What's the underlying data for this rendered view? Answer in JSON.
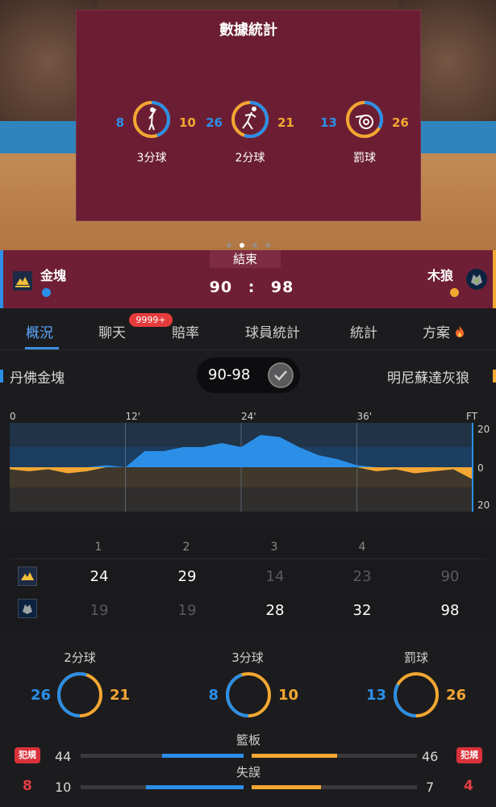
{
  "stats_card": {
    "title": "數據統計",
    "items": [
      {
        "label": "3分球",
        "left": "8",
        "right": "10",
        "icon": "shooter-icon"
      },
      {
        "label": "2分球",
        "left": "26",
        "right": "21",
        "icon": "layup-icon"
      },
      {
        "label": "罰球",
        "left": "13",
        "right": "26",
        "icon": "whistle-icon"
      }
    ],
    "page_count": 4,
    "active_page": 2
  },
  "scorebar": {
    "status": "結束",
    "home": {
      "name": "金塊",
      "color": "#2b8fe8"
    },
    "away": {
      "name": "木狼",
      "color": "#f3a733"
    },
    "home_score": "90",
    "separator": ":",
    "away_score": "98"
  },
  "tabs": [
    {
      "label": "概況",
      "active": true
    },
    {
      "label": "聊天"
    },
    {
      "label": "賠率"
    },
    {
      "label": "球員統計"
    },
    {
      "label": "統計"
    },
    {
      "label": "方案"
    }
  ],
  "chat_badge": "9999+",
  "matchup": {
    "home_full": "丹佛金塊",
    "away_full": "明尼蘇達灰狼",
    "score": "90-98"
  },
  "chart_data": {
    "type": "area",
    "x_ticks": [
      "0",
      "12'",
      "24'",
      "36'",
      "FT"
    ],
    "y_ticks": [
      "20",
      "0",
      "20"
    ],
    "x": [
      0,
      2,
      4,
      6,
      8,
      10,
      12,
      14,
      16,
      18,
      20,
      22,
      24,
      26,
      28,
      30,
      32,
      34,
      36,
      38,
      40,
      42,
      44,
      46,
      48
    ],
    "margin": [
      -1,
      -2,
      -1,
      -3,
      -2,
      1,
      0,
      8,
      8,
      10,
      10,
      12,
      10,
      16,
      15,
      10,
      6,
      4,
      1,
      -2,
      -1,
      -3,
      -2,
      -1,
      -6
    ],
    "colors": {
      "home": "#2b8fe8",
      "away": "#f3a733"
    }
  },
  "quarters": {
    "headers": [
      "1",
      "2",
      "3",
      "4",
      ""
    ],
    "home": [
      "24",
      "29",
      "14",
      "23",
      "90"
    ],
    "away": [
      "19",
      "19",
      "28",
      "32",
      "98"
    ]
  },
  "bottom_stats": {
    "rings": [
      {
        "title": "2分球",
        "left": "26",
        "right": "21"
      },
      {
        "title": "3分球",
        "left": "8",
        "right": "10"
      },
      {
        "title": "罰球",
        "left": "13",
        "right": "26"
      }
    ],
    "rebounds": {
      "label": "籃板",
      "left": "44",
      "right": "46"
    },
    "turnovers": {
      "label": "失誤",
      "left": "10",
      "right": "7"
    },
    "fouls": {
      "label": "犯規",
      "left": "8",
      "right": "4"
    }
  }
}
